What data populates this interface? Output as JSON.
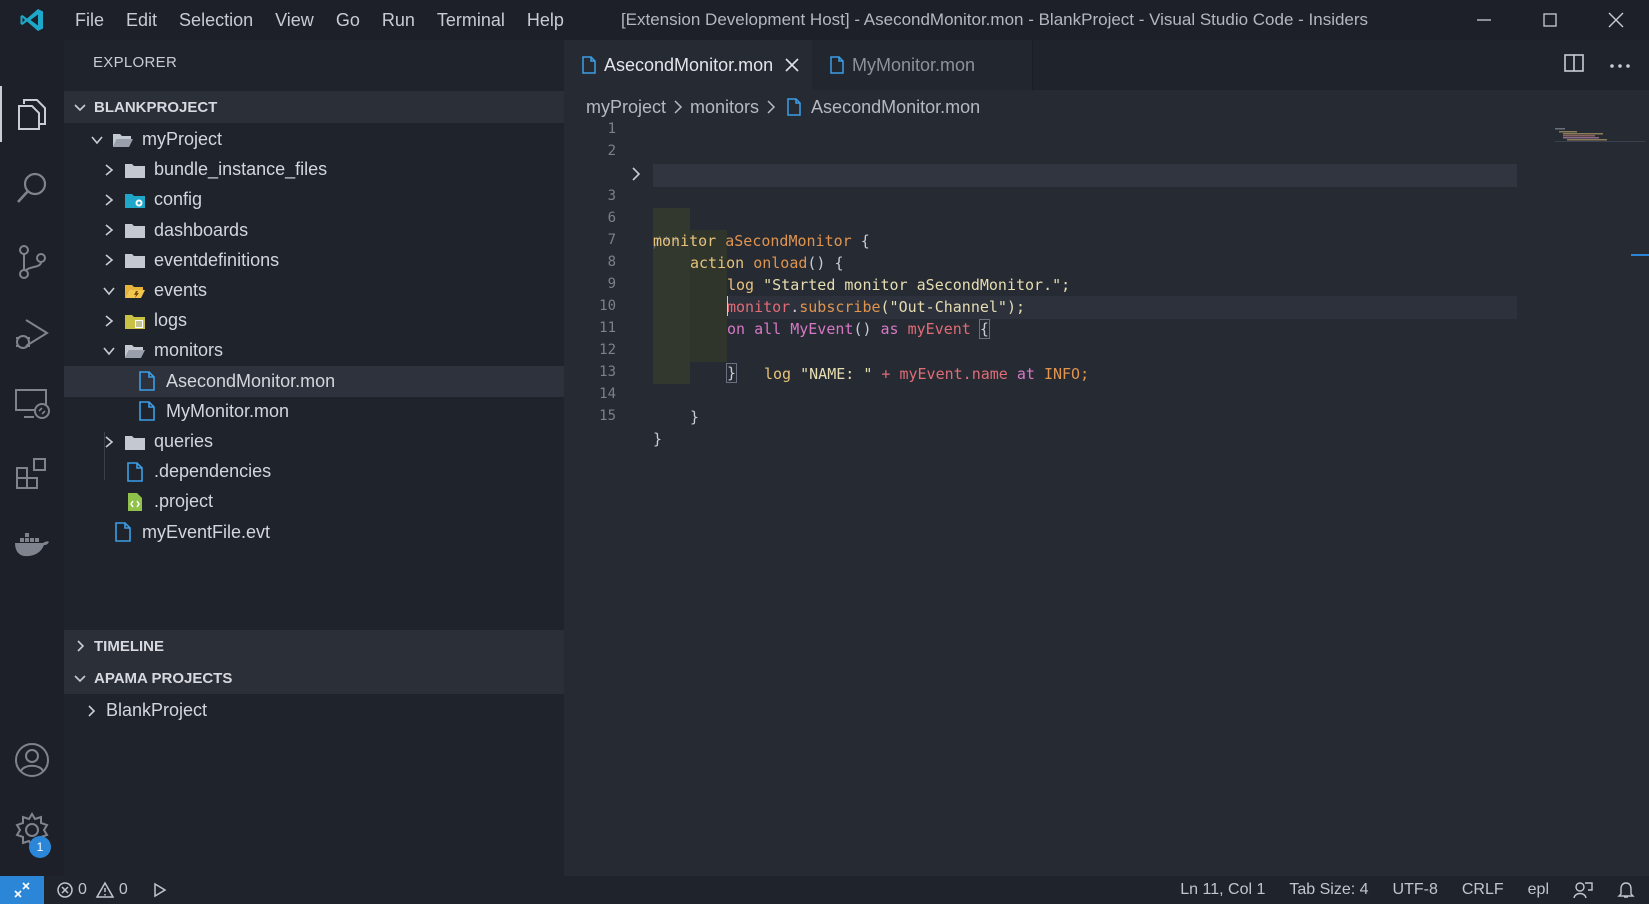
{
  "window": {
    "title": "[Extension Development Host] - AsecondMonitor.mon - BlankProject - Visual Studio Code - Insiders"
  },
  "menu": [
    "File",
    "Edit",
    "Selection",
    "View",
    "Go",
    "Run",
    "Terminal",
    "Help"
  ],
  "activity_bar": {
    "icons": [
      "explorer-icon",
      "search-icon",
      "source-control-icon",
      "run-debug-icon",
      "remote-explorer-icon",
      "extensions-icon",
      "docker-icon",
      "account-icon",
      "manage-gear-icon"
    ],
    "settings_badge": "1"
  },
  "sidebar": {
    "title": "EXPLORER",
    "project_section": "BLANKPROJECT",
    "tree": [
      {
        "label": "myProject",
        "type": "folder-open",
        "expanded": true
      },
      {
        "label": "bundle_instance_files",
        "type": "folder"
      },
      {
        "label": "config",
        "type": "folder-config"
      },
      {
        "label": "dashboards",
        "type": "folder"
      },
      {
        "label": "eventdefinitions",
        "type": "folder"
      },
      {
        "label": "events",
        "type": "folder-events-open",
        "expanded": true
      },
      {
        "label": "logs",
        "type": "folder-logs"
      },
      {
        "label": "monitors",
        "type": "folder-open",
        "expanded": true
      },
      {
        "label": "AsecondMonitor.mon",
        "type": "file",
        "selected": true
      },
      {
        "label": "MyMonitor.mon",
        "type": "file"
      },
      {
        "label": "queries",
        "type": "folder"
      },
      {
        "label": ".dependencies",
        "type": "file"
      },
      {
        "label": ".project",
        "type": "file-project"
      },
      {
        "label": "myEventFile.evt",
        "type": "file"
      }
    ],
    "timeline_section": "TIMELINE",
    "apama_section": "APAMA PROJECTS",
    "apama_items": [
      "BlankProject"
    ]
  },
  "editor": {
    "tabs": [
      {
        "label": "AsecondMonitor.mon",
        "active": true
      },
      {
        "label": "MyMonitor.mon",
        "active": false
      }
    ],
    "breadcrumb": [
      "myProject",
      "monitors",
      "AsecondMonitor.mon"
    ],
    "line_numbers": [
      "1",
      "2",
      "3",
      "6",
      "7",
      "8",
      "9",
      "10",
      "11",
      "12",
      "13",
      "14",
      "15"
    ],
    "code": {
      "l3_folded": "/**",
      "l3_ellipsis": "···",
      "l6_kw": "monitor",
      "l6_name": "aSecondMonitor",
      "l6_brace": " {",
      "l7_kw": "action",
      "l7_fn": "onload",
      "l7_rest": "() {",
      "l8_kw": "log",
      "l8_str": "\"Started monitor aSecondMonitor.\";",
      "l9_a": "monitor",
      "l9_b": ".",
      "l9_c": "subscribe",
      "l9_d": "(\"Out-Channel\");",
      "l10_on": "on",
      "l10_all": "all",
      "l10_event": "MyEvent",
      "l10_paren": "()",
      "l10_as": "as",
      "l10_var": "myEvent",
      "l10_brace": "{",
      "l11_log": "log",
      "l11_str": "\"NAME: \"",
      "l11_plus": "+",
      "l11_var": "myEvent.name",
      "l11_at": "at",
      "l11_info": "INFO;",
      "l12": "}",
      "l14": "}",
      "l15": "}"
    }
  },
  "statusbar": {
    "errors": "0",
    "warnings": "0",
    "position": "Ln 11, Col 1",
    "tab_size": "Tab Size: 4",
    "encoding": "UTF-8",
    "eol": "CRLF",
    "language": "epl"
  }
}
